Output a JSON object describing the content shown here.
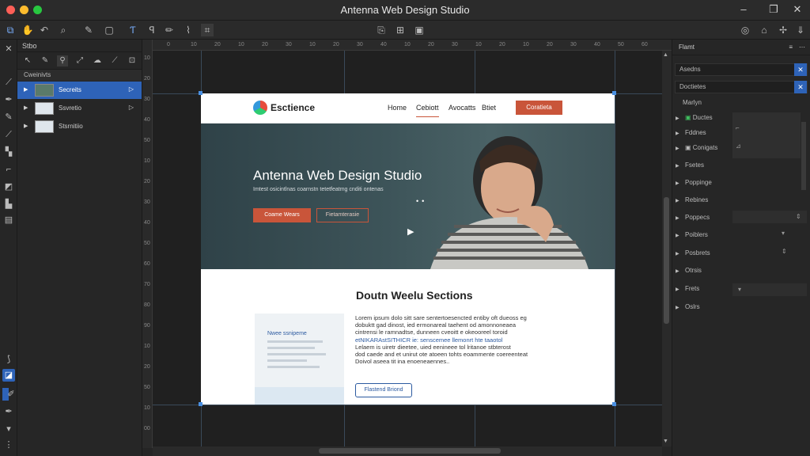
{
  "window": {
    "title": "Antenna Web Design Studio",
    "traffic_colors": [
      "#fe5f57",
      "#febc2e",
      "#28c840"
    ],
    "controls": [
      "–",
      "❐",
      "✕"
    ]
  },
  "toolbar": {
    "left_icons": [
      "layers-icon",
      "hand-icon",
      "undo-icon",
      "search-icon",
      "pen-tool-icon",
      "frame-icon",
      "text-icon",
      "brush-icon",
      "pencil-icon",
      "vector-icon"
    ],
    "center_icons": [
      "copy-icon",
      "grid-icon",
      "save-icon"
    ],
    "right_icons": [
      "globe-icon",
      "bell-icon",
      "share-icon",
      "download-icon"
    ]
  },
  "layers_panel": {
    "title": "Stbo",
    "group_label": "Cweinivts",
    "layers": [
      {
        "name": "Secreits",
        "selected": true
      },
      {
        "name": "Ssvretio",
        "selected": false
      },
      {
        "name": "Stsrnitiio",
        "selected": false
      }
    ]
  },
  "ruler": {
    "h_ticks": [
      "0",
      "10",
      "20",
      "10",
      "20",
      "30",
      "10",
      "20",
      "30",
      "40",
      "10",
      "20",
      "30",
      "10",
      "20",
      "10",
      "20",
      "30",
      "40",
      "50",
      "60"
    ],
    "v_ticks": [
      "10",
      "20",
      "30",
      "40",
      "50",
      "10",
      "20",
      "30",
      "40",
      "50",
      "60",
      "70",
      "80",
      "90",
      "10",
      "20",
      "50",
      "10",
      "00"
    ]
  },
  "site": {
    "brand": "Esctience",
    "nav": [
      "Home",
      "Cebiott",
      "Avocatts",
      "Btiet"
    ],
    "nav_active": 1,
    "cta": "Coratieta",
    "hero_title": "Antenna Web Design Studio",
    "hero_sub": "Imtest osicintlnas coarnstn tetetfeatmg cnditi ontenas",
    "hero_btn_primary": "Coame Wears",
    "hero_btn_secondary": "Fietamterasie",
    "section_title": "Doutn Weelu Sections",
    "card_title": "Nwee ssnipeme",
    "body_lines": [
      "Lorem ipsum dolo sitt sare sentertoesencted entiby oft dueoss eg",
      "dobuktt gad dinost, ied ermonareal taehent od amonnoneaea",
      "cintrensi le ramnadtse, dunneen cveoitt e okeooreel toroid",
      "etNIKARAstSITHICR ie: senscemee llemonrt hte taaotol",
      "Lelaem is uiretr dieetee, uied eenineee tol lritanoe stbterost",
      "dod caede and et unirut ote atoeen tohts eoammente coereenteat",
      "Doivol aseea tit ina enoeneaennes.."
    ],
    "read_more": "Flastend Briond"
  },
  "properties_panel": {
    "title": "Flamt",
    "field1": "Asedns",
    "field2": "Doctietes",
    "section": "Marlyn",
    "items": [
      "Ductes",
      "Fddnes",
      "Conigats",
      "Fsetes",
      "Poppinge",
      "Rebines",
      "Poppecs",
      "Poiblers",
      "Posbrets",
      "Otrsis",
      "Frets",
      "Oslrs"
    ]
  },
  "colors": {
    "accent": "#2e63b8",
    "brand_orange": "#c9553a",
    "link_blue": "#2c5aa0"
  }
}
